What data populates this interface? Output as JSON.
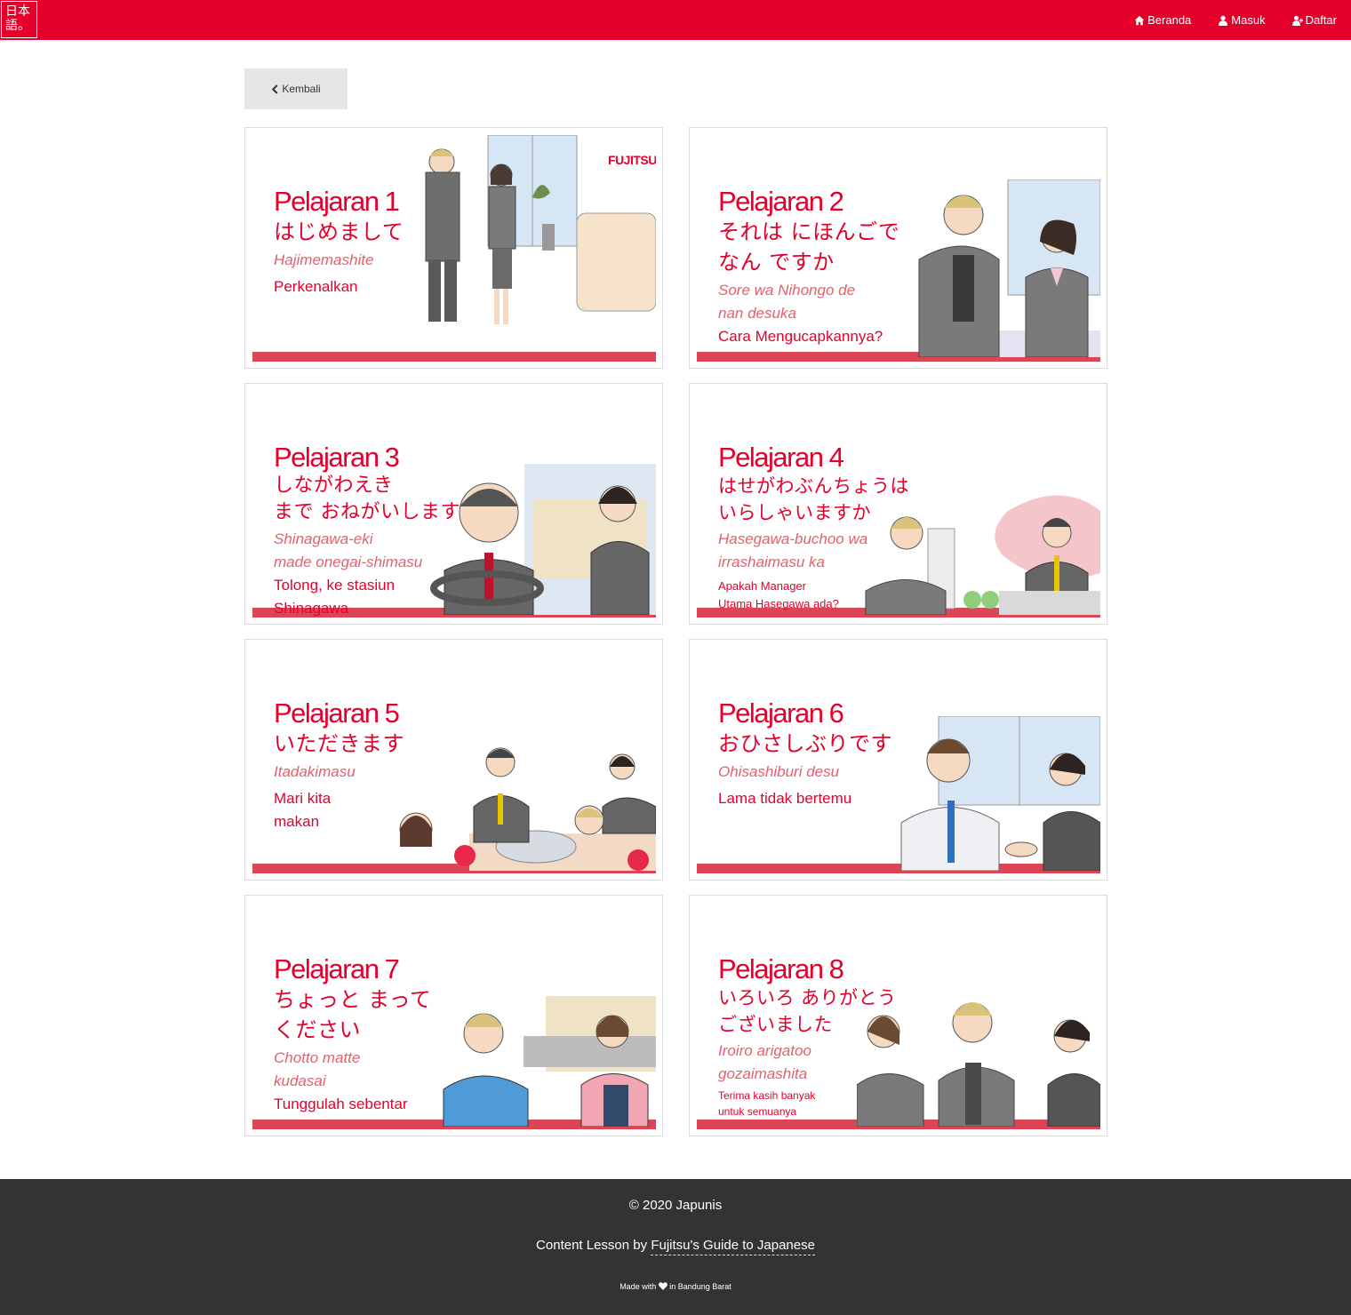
{
  "brand": {
    "line1": "日本",
    "line2": "語。"
  },
  "nav": {
    "home": "Beranda",
    "login": "Masuk",
    "register": "Daftar"
  },
  "back_label": "Kembali",
  "lessons": [
    {
      "title": "Pelajaran 1",
      "jp": "はじめまして",
      "romaji": "Hajimemashite",
      "id": "Perkenalkan"
    },
    {
      "title": "Pelajaran 2",
      "jp": "それは にほんごで\nなん ですか",
      "romaji": "Sore wa Nihongo de\nnan desuka",
      "id": "Cara Mengucapkannya?"
    },
    {
      "title": "Pelajaran 3",
      "jp": "しながわえき\nまで  おねがいします",
      "romaji": "Shinagawa-eki\nmade onegai-shimasu",
      "id": "Tolong, ke stasiun\nShinagawa"
    },
    {
      "title": "Pelajaran 4",
      "jp": "はせがわぶんちょうは\nいらしゃいますか",
      "romaji": "Hasegawa-buchoo wa\nirrashaimasu ka",
      "id": "Apakah Manager\nUtama Hasegawa ada?"
    },
    {
      "title": "Pelajaran 5",
      "jp": "いただきます",
      "romaji": "Itadakimasu",
      "id": "Mari kita\nmakan"
    },
    {
      "title": "Pelajaran 6",
      "jp": "おひさしぶりです",
      "romaji": "Ohisashiburi desu",
      "id": "Lama tidak bertemu"
    },
    {
      "title": "Pelajaran 7",
      "jp": "ちょっと  まって\nください",
      "romaji": "Chotto matte\nkudasai",
      "id": "Tunggulah sebentar"
    },
    {
      "title": "Pelajaran 8",
      "jp": "いろいろ ありがとう\nございました",
      "romaji": "Iroiro arigatoo\ngozaimashita",
      "id": "Terima kasih banyak\nuntuk semuanya"
    }
  ],
  "logo_text": "FUJITSU",
  "footer": {
    "copyright": "© 2020 Japunis",
    "credit_prefix": "Content Lesson by ",
    "credit_link": "Fujitsu's Guide to Japanese",
    "made_prefix": "Made with",
    "made_suffix": "in Bandung Barat"
  },
  "icons": {
    "home": "home-icon",
    "login": "user-icon",
    "register": "user-plus-icon",
    "back": "chevron-left-icon",
    "heart": "heart-icon"
  },
  "colors": {
    "brand_red": "#e4002b",
    "stripe": "#dc4556",
    "footer_bg": "#333333",
    "back_btn_bg": "#e6e6e6"
  }
}
